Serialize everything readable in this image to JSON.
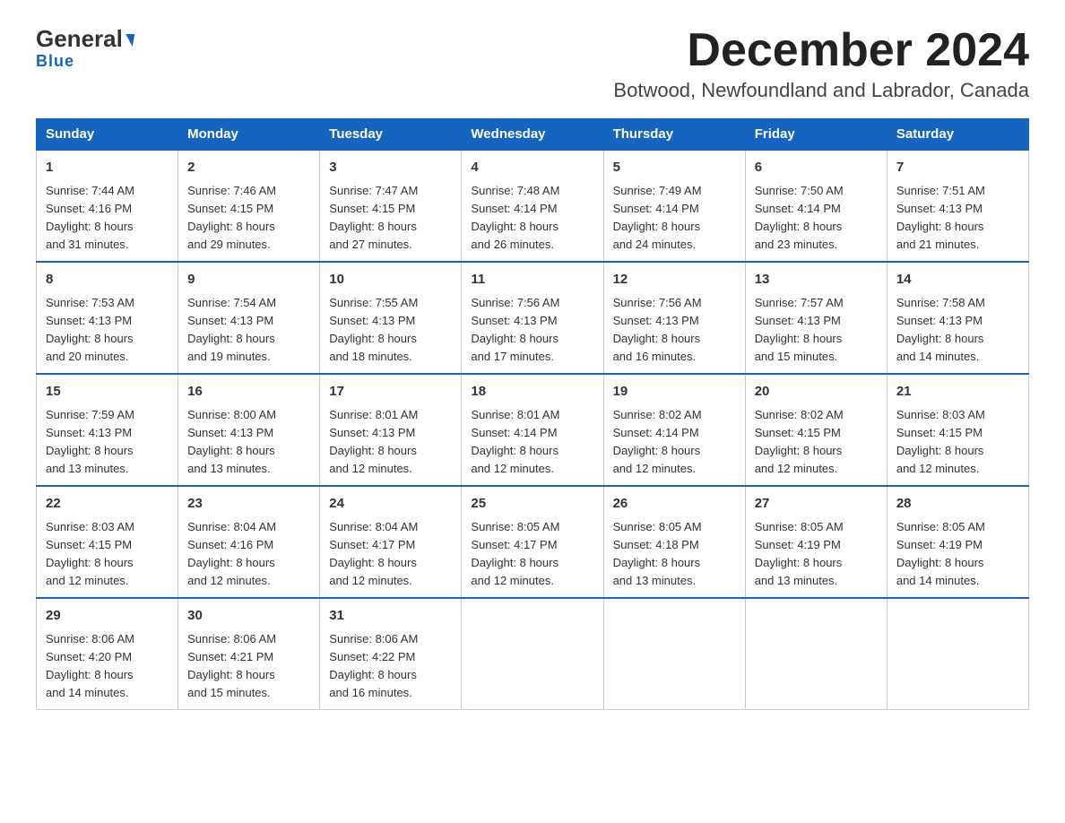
{
  "logo": {
    "general": "General",
    "arrow": "",
    "blue": "Blue"
  },
  "header": {
    "month_year": "December 2024",
    "location": "Botwood, Newfoundland and Labrador, Canada"
  },
  "days_of_week": [
    "Sunday",
    "Monday",
    "Tuesday",
    "Wednesday",
    "Thursday",
    "Friday",
    "Saturday"
  ],
  "weeks": [
    [
      {
        "day": "1",
        "sunrise": "7:44 AM",
        "sunset": "4:16 PM",
        "daylight": "8 hours and 31 minutes."
      },
      {
        "day": "2",
        "sunrise": "7:46 AM",
        "sunset": "4:15 PM",
        "daylight": "8 hours and 29 minutes."
      },
      {
        "day": "3",
        "sunrise": "7:47 AM",
        "sunset": "4:15 PM",
        "daylight": "8 hours and 27 minutes."
      },
      {
        "day": "4",
        "sunrise": "7:48 AM",
        "sunset": "4:14 PM",
        "daylight": "8 hours and 26 minutes."
      },
      {
        "day": "5",
        "sunrise": "7:49 AM",
        "sunset": "4:14 PM",
        "daylight": "8 hours and 24 minutes."
      },
      {
        "day": "6",
        "sunrise": "7:50 AM",
        "sunset": "4:14 PM",
        "daylight": "8 hours and 23 minutes."
      },
      {
        "day": "7",
        "sunrise": "7:51 AM",
        "sunset": "4:13 PM",
        "daylight": "8 hours and 21 minutes."
      }
    ],
    [
      {
        "day": "8",
        "sunrise": "7:53 AM",
        "sunset": "4:13 PM",
        "daylight": "8 hours and 20 minutes."
      },
      {
        "day": "9",
        "sunrise": "7:54 AM",
        "sunset": "4:13 PM",
        "daylight": "8 hours and 19 minutes."
      },
      {
        "day": "10",
        "sunrise": "7:55 AM",
        "sunset": "4:13 PM",
        "daylight": "8 hours and 18 minutes."
      },
      {
        "day": "11",
        "sunrise": "7:56 AM",
        "sunset": "4:13 PM",
        "daylight": "8 hours and 17 minutes."
      },
      {
        "day": "12",
        "sunrise": "7:56 AM",
        "sunset": "4:13 PM",
        "daylight": "8 hours and 16 minutes."
      },
      {
        "day": "13",
        "sunrise": "7:57 AM",
        "sunset": "4:13 PM",
        "daylight": "8 hours and 15 minutes."
      },
      {
        "day": "14",
        "sunrise": "7:58 AM",
        "sunset": "4:13 PM",
        "daylight": "8 hours and 14 minutes."
      }
    ],
    [
      {
        "day": "15",
        "sunrise": "7:59 AM",
        "sunset": "4:13 PM",
        "daylight": "8 hours and 13 minutes."
      },
      {
        "day": "16",
        "sunrise": "8:00 AM",
        "sunset": "4:13 PM",
        "daylight": "8 hours and 13 minutes."
      },
      {
        "day": "17",
        "sunrise": "8:01 AM",
        "sunset": "4:13 PM",
        "daylight": "8 hours and 12 minutes."
      },
      {
        "day": "18",
        "sunrise": "8:01 AM",
        "sunset": "4:14 PM",
        "daylight": "8 hours and 12 minutes."
      },
      {
        "day": "19",
        "sunrise": "8:02 AM",
        "sunset": "4:14 PM",
        "daylight": "8 hours and 12 minutes."
      },
      {
        "day": "20",
        "sunrise": "8:02 AM",
        "sunset": "4:15 PM",
        "daylight": "8 hours and 12 minutes."
      },
      {
        "day": "21",
        "sunrise": "8:03 AM",
        "sunset": "4:15 PM",
        "daylight": "8 hours and 12 minutes."
      }
    ],
    [
      {
        "day": "22",
        "sunrise": "8:03 AM",
        "sunset": "4:15 PM",
        "daylight": "8 hours and 12 minutes."
      },
      {
        "day": "23",
        "sunrise": "8:04 AM",
        "sunset": "4:16 PM",
        "daylight": "8 hours and 12 minutes."
      },
      {
        "day": "24",
        "sunrise": "8:04 AM",
        "sunset": "4:17 PM",
        "daylight": "8 hours and 12 minutes."
      },
      {
        "day": "25",
        "sunrise": "8:05 AM",
        "sunset": "4:17 PM",
        "daylight": "8 hours and 12 minutes."
      },
      {
        "day": "26",
        "sunrise": "8:05 AM",
        "sunset": "4:18 PM",
        "daylight": "8 hours and 13 minutes."
      },
      {
        "day": "27",
        "sunrise": "8:05 AM",
        "sunset": "4:19 PM",
        "daylight": "8 hours and 13 minutes."
      },
      {
        "day": "28",
        "sunrise": "8:05 AM",
        "sunset": "4:19 PM",
        "daylight": "8 hours and 14 minutes."
      }
    ],
    [
      {
        "day": "29",
        "sunrise": "8:06 AM",
        "sunset": "4:20 PM",
        "daylight": "8 hours and 14 minutes."
      },
      {
        "day": "30",
        "sunrise": "8:06 AM",
        "sunset": "4:21 PM",
        "daylight": "8 hours and 15 minutes."
      },
      {
        "day": "31",
        "sunrise": "8:06 AM",
        "sunset": "4:22 PM",
        "daylight": "8 hours and 16 minutes."
      },
      null,
      null,
      null,
      null
    ]
  ],
  "labels": {
    "sunrise": "Sunrise:",
    "sunset": "Sunset:",
    "daylight": "Daylight:"
  }
}
